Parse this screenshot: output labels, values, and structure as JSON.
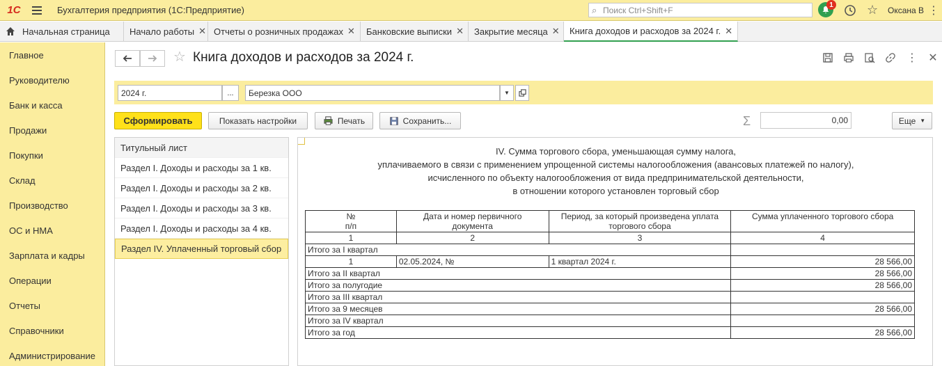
{
  "app": {
    "logo_text": "1С",
    "title": "Бухгалтерия предприятия  (1С:Предприятие)",
    "search_placeholder": "Поиск Ctrl+Shift+F",
    "notification_count": "1",
    "user": "Оксана В"
  },
  "tabs": [
    {
      "label": "Начальная страница",
      "closable": false
    },
    {
      "label": "Начало работы",
      "closable": true
    },
    {
      "label": "Отчеты о розничных продажах",
      "closable": true
    },
    {
      "label": "Банковские выписки",
      "closable": true
    },
    {
      "label": "Закрытие месяца",
      "closable": true
    },
    {
      "label": "Книга доходов и расходов за 2024 г.",
      "closable": true,
      "active": true
    }
  ],
  "sidebar": {
    "items": [
      "Главное",
      "Руководителю",
      "Банк и касса",
      "Продажи",
      "Покупки",
      "Склад",
      "Производство",
      "ОС и НМА",
      "Зарплата и кадры",
      "Операции",
      "Отчеты",
      "Справочники",
      "Администрирование"
    ]
  },
  "document": {
    "title": "Книга доходов и расходов за 2024 г.",
    "period": "2024 г.",
    "period_button": "...",
    "organization": "Березка ООО"
  },
  "toolbar": {
    "generate": "Сформировать",
    "settings": "Показать настройки",
    "print": "Печать",
    "save": "Сохранить...",
    "sigma": "Σ",
    "sum": "0,00",
    "more": "Еще"
  },
  "sections": [
    "Титульный лист",
    "Раздел I. Доходы и расходы за 1 кв.",
    "Раздел I. Доходы и расходы за 2 кв.",
    "Раздел I. Доходы и расходы за 3 кв.",
    "Раздел I. Доходы и расходы за 4 кв.",
    "Раздел IV. Уплаченный торговый сбор"
  ],
  "report": {
    "title_lines": [
      "IV. Сумма торгового сбора, уменьшающая сумму налога,",
      "уплачиваемого в связи с применением упрощенной системы налогообложения (авансовых платежей по налогу),",
      "исчисленного по объекту налогообложения от вида предпринимательской деятельности,",
      "в отношении которого установлен торговый сбор"
    ],
    "headers": [
      "№\nп/п",
      "Дата и номер первичного\nдокумента",
      "Период, за который произведена уплата\nторгового сбора",
      "Сумма уплаченного торгового сбора"
    ],
    "col_numbers": [
      "1",
      "2",
      "3",
      "4"
    ],
    "rows": [
      {
        "type": "total",
        "label": "Итого за I квартал",
        "sum": ""
      },
      {
        "type": "data",
        "num": "1",
        "doc": "02.05.2024, №",
        "period": "1 квартал 2024 г.",
        "sum": "28 566,00"
      },
      {
        "type": "total",
        "label": "Итого за II квартал",
        "sum": "28 566,00"
      },
      {
        "type": "total",
        "label": "Итого за полугодие",
        "sum": "28 566,00"
      },
      {
        "type": "total",
        "label": "Итого за III квартал",
        "sum": ""
      },
      {
        "type": "total",
        "label": "Итого за 9 месяцев",
        "sum": "28 566,00"
      },
      {
        "type": "total",
        "label": "Итого за IV квартал",
        "sum": ""
      },
      {
        "type": "total",
        "label": "Итого за год",
        "sum": "28 566,00"
      }
    ]
  },
  "colors": {
    "accent_yellow": "#fbed9e",
    "primary_button": "#ffe11a",
    "active_tab_underline": "#32a050",
    "notification_green": "#30a050",
    "badge_red": "#e0301e"
  },
  "icons": [
    "home-icon",
    "back-arrow-icon",
    "forward-arrow-icon",
    "favorite-star-icon",
    "save-disk-icon",
    "print-icon",
    "preview-icon",
    "link-icon",
    "more-vertical-icon",
    "close-icon",
    "bell-icon",
    "history-icon"
  ]
}
